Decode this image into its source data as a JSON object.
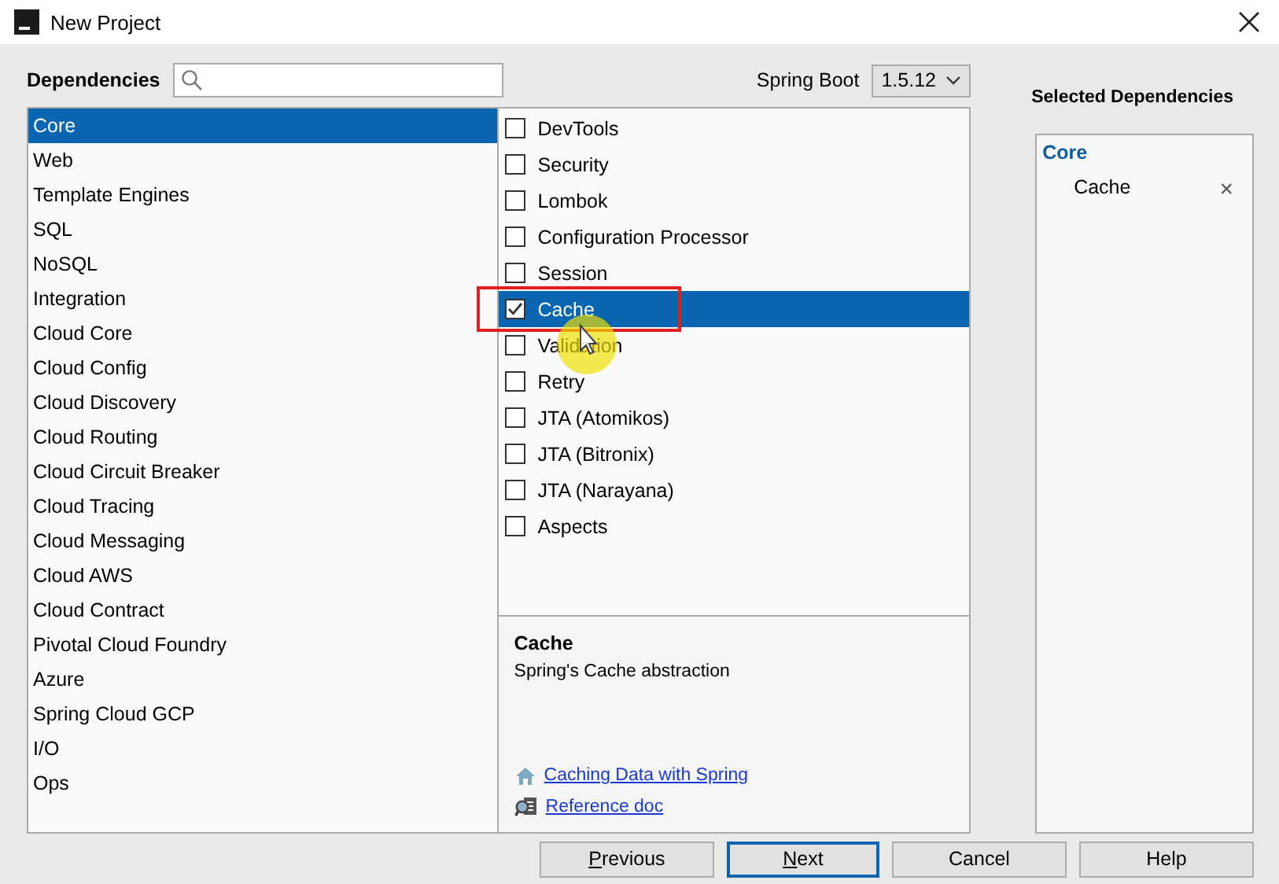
{
  "window": {
    "title": "New Project"
  },
  "header": {
    "label": "Dependencies",
    "boot_label": "Spring Boot",
    "boot_version": "1.5.12"
  },
  "categories": [
    {
      "label": "Core",
      "selected": true
    },
    {
      "label": "Web",
      "selected": false
    },
    {
      "label": "Template Engines",
      "selected": false
    },
    {
      "label": "SQL",
      "selected": false
    },
    {
      "label": "NoSQL",
      "selected": false
    },
    {
      "label": "Integration",
      "selected": false
    },
    {
      "label": "Cloud Core",
      "selected": false
    },
    {
      "label": "Cloud Config",
      "selected": false
    },
    {
      "label": "Cloud Discovery",
      "selected": false
    },
    {
      "label": "Cloud Routing",
      "selected": false
    },
    {
      "label": "Cloud Circuit Breaker",
      "selected": false
    },
    {
      "label": "Cloud Tracing",
      "selected": false
    },
    {
      "label": "Cloud Messaging",
      "selected": false
    },
    {
      "label": "Cloud AWS",
      "selected": false
    },
    {
      "label": "Cloud Contract",
      "selected": false
    },
    {
      "label": "Pivotal Cloud Foundry",
      "selected": false
    },
    {
      "label": "Azure",
      "selected": false
    },
    {
      "label": "Spring Cloud GCP",
      "selected": false
    },
    {
      "label": "I/O",
      "selected": false
    },
    {
      "label": "Ops",
      "selected": false
    }
  ],
  "dependencies": [
    {
      "label": "DevTools",
      "checked": false,
      "selected": false
    },
    {
      "label": "Security",
      "checked": false,
      "selected": false
    },
    {
      "label": "Lombok",
      "checked": false,
      "selected": false
    },
    {
      "label": "Configuration Processor",
      "checked": false,
      "selected": false
    },
    {
      "label": "Session",
      "checked": false,
      "selected": false
    },
    {
      "label": "Cache",
      "checked": true,
      "selected": true,
      "boxed": true
    },
    {
      "label": "Validation",
      "checked": false,
      "selected": false,
      "cursor": true
    },
    {
      "label": "Retry",
      "checked": false,
      "selected": false
    },
    {
      "label": "JTA (Atomikos)",
      "checked": false,
      "selected": false
    },
    {
      "label": "JTA (Bitronix)",
      "checked": false,
      "selected": false
    },
    {
      "label": "JTA (Narayana)",
      "checked": false,
      "selected": false
    },
    {
      "label": "Aspects",
      "checked": false,
      "selected": false
    }
  ],
  "details": {
    "title": "Cache",
    "description": "Spring's Cache abstraction",
    "links": [
      {
        "kind": "guide",
        "label": "Caching Data with Spring"
      },
      {
        "kind": "reference",
        "label": "Reference doc"
      }
    ]
  },
  "selected_panel": {
    "title": "Selected Dependencies",
    "groups": [
      {
        "name": "Core",
        "items": [
          {
            "label": "Cache",
            "remove": "×"
          }
        ]
      }
    ]
  },
  "buttons": [
    {
      "label": "Previous",
      "mnemonic": true,
      "default": false
    },
    {
      "label": "Next",
      "mnemonic": true,
      "default": true
    },
    {
      "label": "Cancel",
      "mnemonic": false,
      "default": false
    },
    {
      "label": "Help",
      "mnemonic": false,
      "default": false
    }
  ]
}
